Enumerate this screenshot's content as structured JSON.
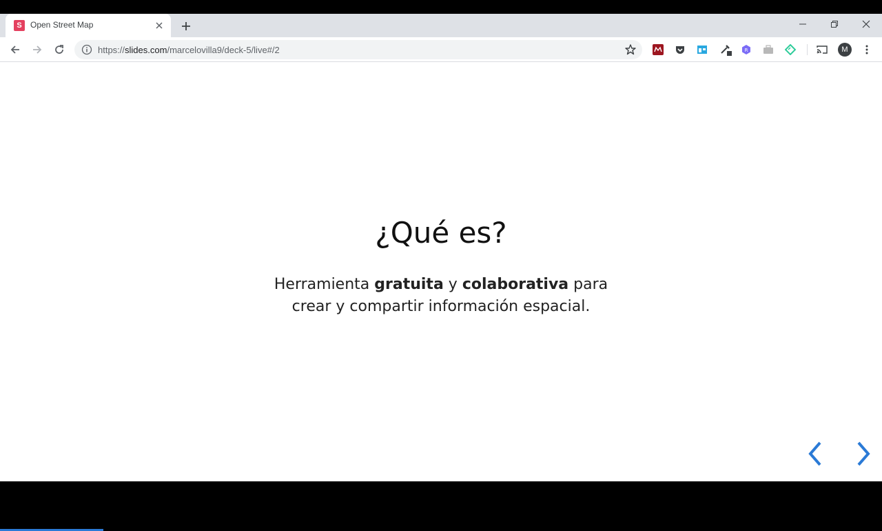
{
  "browser": {
    "tab": {
      "title": "Open Street Map",
      "favicon_letter": "S",
      "favicon_color": "#e4405f"
    },
    "address": {
      "scheme": "https://",
      "host": "slides.com",
      "path": "/marcelovilla9/deck-5/live#/2"
    },
    "profile_initial": "M",
    "extensions": [
      "mendeley-icon",
      "pocket-icon",
      "window-icon",
      "dropper-icon",
      "hexagon-icon",
      "briefcase-icon",
      "diamond-icon"
    ]
  },
  "slide": {
    "title": "¿Qué es?",
    "line1": {
      "pre": "Herramienta ",
      "bold1": "gratuita",
      "mid": " y ",
      "bold2": "colaborativa",
      "post": " para"
    },
    "line2": "crear y compartir información espacial.",
    "accent_color": "#2a7ad6",
    "progress_fraction": 0.117
  }
}
